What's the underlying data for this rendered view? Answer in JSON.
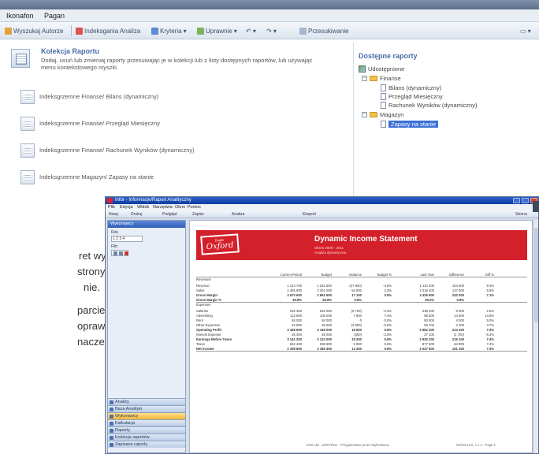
{
  "back_window": {
    "menu": [
      "Ikonafon",
      "Pagan"
    ],
    "toolbar": {
      "items": [
        "Wyszukaj Autorze",
        "Indeksgania Analiza",
        "Kryteria",
        "Uprawnie",
        "Przesukiwanie"
      ]
    },
    "collection": {
      "title": "Kolekcja Raportu",
      "description": "Dodaj, usuń lub zmieniaj raporty przesuwając je w kolekcji lub z listy dostępnych raportów, lub używając menu kontekstowego myszki.",
      "items": [
        "Indeksgrzemne Finanse/ Bilans (dynamiczny)",
        "Indeksgrzemne Finanse/ Przegląd Miesięczny",
        "Indeksgrzemne Finanse/ Rachunek Wyników (dynamiczny)",
        "Indeksgrzemne Magazyn/ Zapasy na stanie"
      ]
    },
    "available": {
      "title": "Dostępne raporty",
      "root": "Udostępnione",
      "folder1": "Finanse",
      "folder1_items": [
        "Bilans (dynamiczny)",
        "Przegląd Miesięczny",
        "Rachunek Wyników (dynamiczny)"
      ],
      "folder2": "Magazyn",
      "folder2_items": [
        "Zapasy na stanie"
      ]
    }
  },
  "page_text": [
    "ret wysłana",
    "strony są",
    "nie.",
    "parcie dla",
    "oprawioną",
    "naczeniem"
  ],
  "front_window": {
    "title": "Infor - Informacje/Raport Analityczny",
    "menu": [
      "Plik",
      "Edycja",
      "Widok",
      "Narzędzia",
      "Okno",
      "Pomoc"
    ],
    "toolbar": [
      "Nowy",
      "Drukuj",
      "Podgląd",
      "Zapisz",
      "Analiza",
      "Eksport",
      "Strona"
    ],
    "sidebar": {
      "header": "Wykonawcy",
      "label1": "Rok",
      "box_value": "1 2 3 4",
      "label2": "Filtr",
      "nav": [
        "Analizy",
        "Baza Analityki",
        "Wykonawcy",
        "Kalkulacja",
        "Raporty",
        "Kolekcje raportów",
        "Zapisane raporty"
      ],
      "active_nav": "Wykonawcy"
    },
    "report": {
      "logo_small": "Dealer",
      "logo_big": "Oxford",
      "title": "Dynamic Income Statement",
      "sub1": "Okres 2009 - 2011",
      "sub2": "Analiza dynamiczna",
      "columns": [
        "Current Period",
        "Budget",
        "Variance",
        "Budget %",
        "Last Year",
        "Difference",
        "Diff %"
      ],
      "rows": [
        {
          "label": "Revenues",
          "values": []
        },
        {
          "label": "Revenue",
          "values": [
            "1 214 700",
            "1 252 500",
            "(37 800)",
            "-3.0%",
            "1 110 200",
            "104 500",
            "9.4%"
          ]
        },
        {
          "label": "Sales",
          "values": [
            "2 455 900",
            "2 401 000",
            "54 900",
            "2.3%",
            "2 318 400",
            "137 500",
            "5.9%"
          ]
        },
        {
          "label": "Gross Margin",
          "values": [
            "3 670 600",
            "3 653 500",
            "17 100",
            "0.5%",
            "3 428 600",
            "242 000",
            "7.1%"
          ],
          "bold": true
        },
        {
          "label": "Gross Margin %",
          "values": [
            "36.8%",
            "35.9%",
            "0.9%",
            "",
            "36.0%",
            "0.8%",
            ""
          ],
          "bold": true,
          "rule": true
        },
        {
          "label": "Expenses",
          "values": []
        },
        {
          "label": "Salaries",
          "values": [
            "245 300",
            "251 000",
            "(5 700)",
            "-2.3%",
            "238 400",
            "6 900",
            "2.9%"
          ]
        },
        {
          "label": "Advertising",
          "values": [
            "112 800",
            "105 000",
            "7 800",
            "7.4%",
            "98 300",
            "14 500",
            "14.8%"
          ]
        },
        {
          "label": "Rent",
          "values": [
            "84 000",
            "84 000",
            "0",
            "0.0%",
            "80 000",
            "4 000",
            "5.0%"
          ]
        },
        {
          "label": "Other Expenses",
          "values": [
            "61 900",
            "65 500",
            "(3 600)",
            "-5.5%",
            "59 700",
            "2 200",
            "3.7%"
          ]
        },
        {
          "label": "Operating Profit",
          "values": [
            "3 166 600",
            "3 148 000",
            "18 600",
            "0.6%",
            "2 952 200",
            "214 400",
            "7.3%"
          ],
          "bold": true
        },
        {
          "label": "Interest Expense",
          "values": [
            "25 400",
            "26 000",
            "(600)",
            "-2.3%",
            "27 100",
            "(1 700)",
            "-6.3%"
          ]
        },
        {
          "label": "Earnings Before Taxes",
          "values": [
            "3 141 200",
            "3 122 000",
            "19 200",
            "0.6%",
            "2 925 100",
            "216 100",
            "7.4%"
          ],
          "bold": true
        },
        {
          "label": "Taxes",
          "values": [
            "942 400",
            "936 600",
            "5 800",
            "0.6%",
            "877 500",
            "64 900",
            "7.4%"
          ]
        },
        {
          "label": "Net Income",
          "values": [
            "2 198 800",
            "2 185 400",
            "13 400",
            "0.6%",
            "2 047 600",
            "151 200",
            "7.4%"
          ],
          "bold": true,
          "rule": true
        }
      ],
      "footer_left": "Infor Ltd., 12/07/2011 - Przygotowane przez Wykonawcę",
      "footer_right": "Oxford LLD, 1 z 1 - Page 1"
    }
  }
}
